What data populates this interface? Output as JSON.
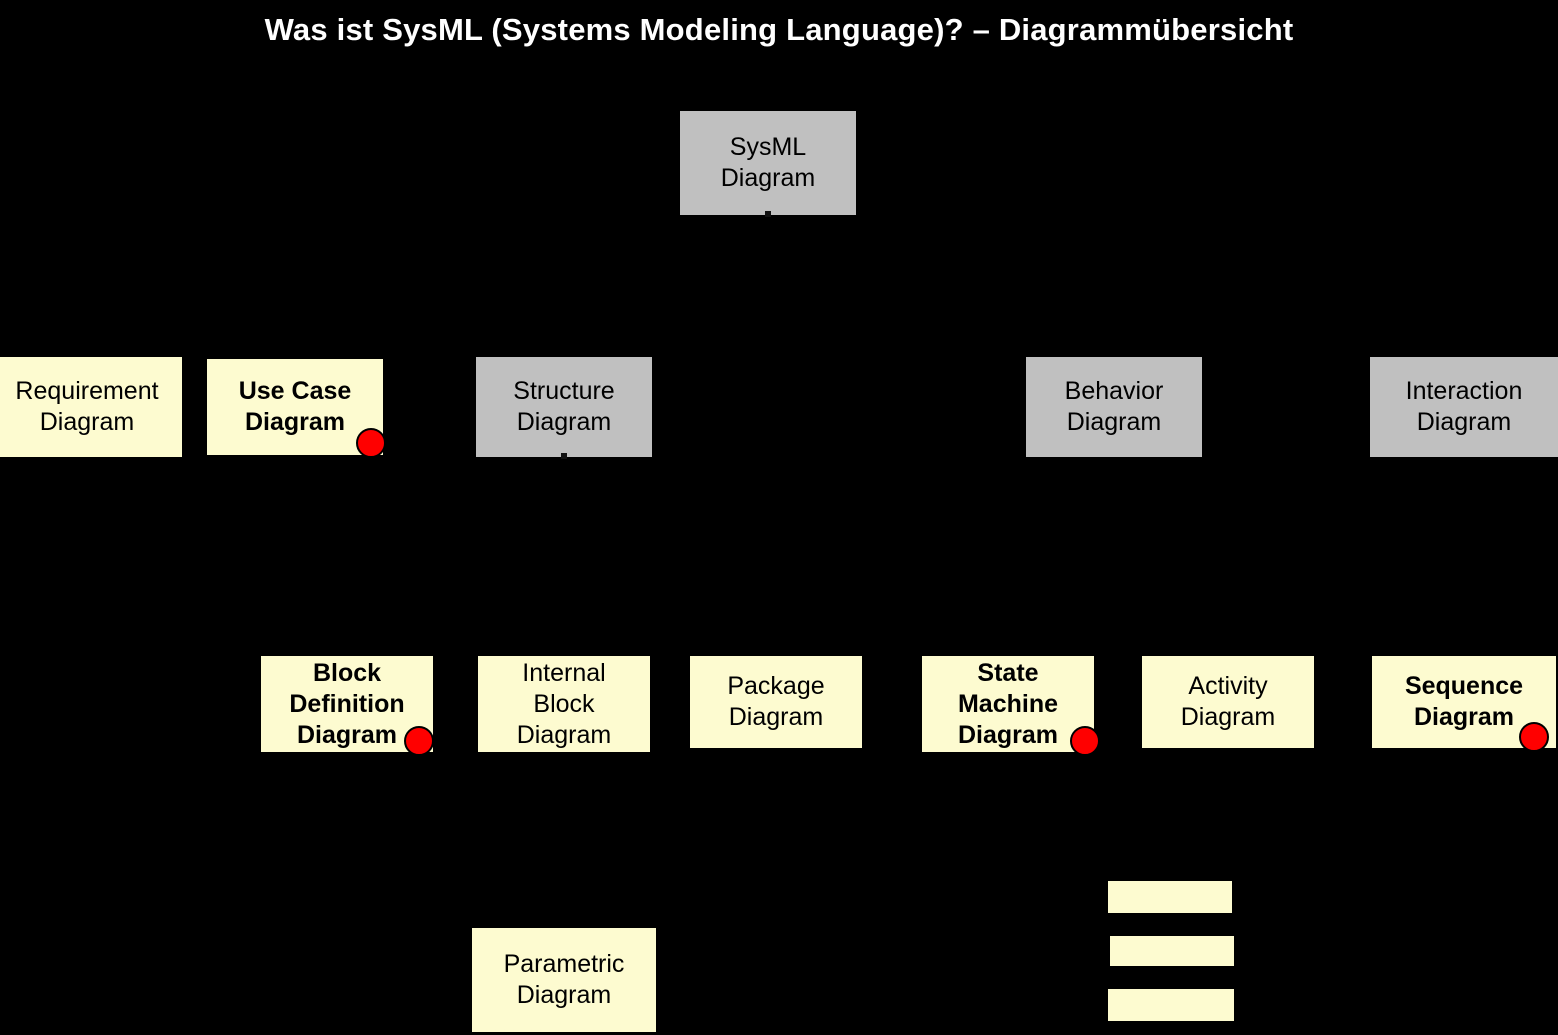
{
  "page": {
    "title": "Was ist SysML (Systems Modeling Language)? –  Diagrammübersicht",
    "background_color": "#000000",
    "title_color": "#ffffff"
  },
  "palette": {
    "grey_node": "#c0c0c0",
    "yellow_node": "#fdfbd0",
    "marker_red": "#ff0000",
    "outline_black": "#000000"
  },
  "nodes": {
    "root": {
      "label": "SysML\nDiagram",
      "fill": "grey",
      "border": "none",
      "bold": false,
      "marker": false
    },
    "level2": [
      {
        "id": "requirement-diagram",
        "label": "Requirement\nDiagram",
        "fill": "yellow",
        "border": "dashed",
        "bold": false,
        "marker": false
      },
      {
        "id": "use-case-diagram",
        "label": "Use Case\nDiagram",
        "fill": "yellow",
        "border": "solid",
        "bold": true,
        "marker": true
      },
      {
        "id": "structure-diagram",
        "label": "Structure\nDiagram",
        "fill": "grey",
        "border": "none",
        "bold": false,
        "marker": false
      },
      {
        "id": "behavior-diagram",
        "label": "Behavior\nDiagram",
        "fill": "grey",
        "border": "none",
        "bold": false,
        "marker": false
      },
      {
        "id": "interaction-diagram",
        "label": "Interaction\nDiagram",
        "fill": "grey",
        "border": "none",
        "bold": false,
        "marker": false
      }
    ],
    "level3": [
      {
        "id": "block-definition-diagram",
        "label": "Block\nDefinition\nDiagram",
        "fill": "yellow",
        "border": "solid",
        "bold": true,
        "marker": true
      },
      {
        "id": "internal-block-diagram",
        "label": "Internal\nBlock\nDiagram",
        "fill": "yellow",
        "border": "solid",
        "bold": false,
        "marker": false
      },
      {
        "id": "package-diagram",
        "label": "Package\nDiagram",
        "fill": "yellow",
        "border": "solid",
        "bold": false,
        "marker": false
      },
      {
        "id": "state-machine-diagram",
        "label": "State\nMachine\nDiagram",
        "fill": "yellow",
        "border": "solid",
        "bold": true,
        "marker": true
      },
      {
        "id": "activity-diagram",
        "label": "Activity\nDiagram",
        "fill": "yellow",
        "border": "solid",
        "bold": false,
        "marker": false
      },
      {
        "id": "sequence-diagram",
        "label": "Sequence\nDiagram",
        "fill": "yellow",
        "border": "solid",
        "bold": true,
        "marker": true
      }
    ],
    "level4": [
      {
        "id": "parametric-diagram",
        "label": "Parametric\nDiagram",
        "fill": "yellow",
        "border": "dashed",
        "bold": false,
        "marker": false
      }
    ]
  },
  "legend": {
    "items": [
      {
        "id": "legend-swatch-1",
        "label": "",
        "fill": "yellow",
        "border": "none"
      },
      {
        "id": "legend-swatch-2",
        "label": "",
        "fill": "yellow",
        "border": "none"
      },
      {
        "id": "legend-swatch-3",
        "label": "",
        "fill": "yellow",
        "border": "dashed"
      }
    ]
  }
}
